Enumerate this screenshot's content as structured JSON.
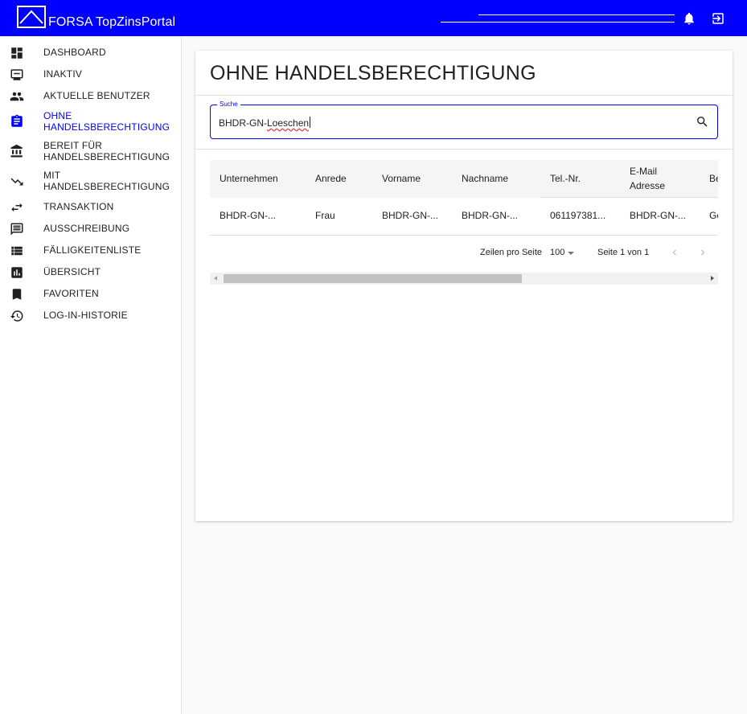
{
  "app": {
    "title": "FORSA TopZinsPortal",
    "brand_color": "#0000ff"
  },
  "header": {
    "icons": [
      "bell-icon",
      "logout-icon"
    ]
  },
  "sidebar": {
    "items": [
      {
        "label": "DASHBOARD",
        "icon": "dashboard-icon"
      },
      {
        "label": "INAKTIV",
        "icon": "monitor-icon"
      },
      {
        "label": "AKTUELLE BENUTZER",
        "icon": "users-icon"
      },
      {
        "label": "OHNE\nHANDELSBERECHTIGUNG",
        "icon": "clipboard-icon",
        "active": true
      },
      {
        "label": "BEREIT FÜR\nHANDELSBERECHTIGUNG",
        "icon": "bank-icon"
      },
      {
        "label": "MIT\nHANDELSBERECHTIGUNG",
        "icon": "trending-down-icon"
      },
      {
        "label": "TRANSAKTION",
        "icon": "swap-icon"
      },
      {
        "label": "AUSSCHREIBUNG",
        "icon": "message-icon"
      },
      {
        "label": "FÄLLIGKEITENLISTE",
        "icon": "list-icon"
      },
      {
        "label": "ÜBERSICHT",
        "icon": "chart-icon"
      },
      {
        "label": "FAVORITEN",
        "icon": "bookmark-icon"
      },
      {
        "label": "LOG-IN-HISTORIE",
        "icon": "history-icon"
      }
    ]
  },
  "main": {
    "title": "OHNE HANDELSBERECHTIGUNG",
    "search": {
      "label": "Suche",
      "value_prefix": "BHDR-GN-",
      "value_suffix": "Loeschen"
    },
    "table": {
      "columns": [
        "Unternehmen",
        "Anrede",
        "Vorname",
        "Nachname",
        "Tel.-Nr.",
        "E-Mail\nAdresse",
        "Be"
      ],
      "rows": [
        [
          "BHDR-GN-...",
          "Frau",
          "BHDR-GN-...",
          "BHDR-GN-...",
          "061197381...",
          "BHDR-GN-...",
          "Ge"
        ]
      ]
    },
    "pagination": {
      "rows_per_page_label": "Zeilen pro Seite",
      "rows_per_page": "100",
      "page_info": "Seite 1 von 1"
    }
  }
}
